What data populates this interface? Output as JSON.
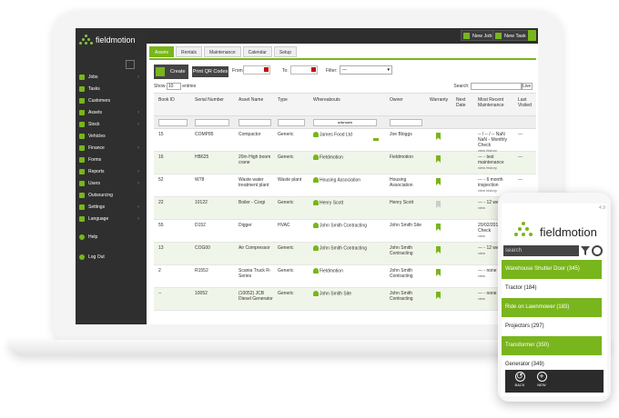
{
  "brand": {
    "name": "fieldmotion"
  },
  "topbar": {
    "new_job": "New Job",
    "new_task": "New Task"
  },
  "sidebar": {
    "items": [
      {
        "label": "Jobs",
        "icon": "jobs-icon",
        "chevron": "›"
      },
      {
        "label": "Tasks",
        "icon": "tasks-icon",
        "chevron": ""
      },
      {
        "label": "Customers",
        "icon": "customers-icon",
        "chevron": ""
      },
      {
        "label": "Assets",
        "icon": "assets-icon",
        "chevron": "›"
      },
      {
        "label": "Stock",
        "icon": "stock-icon",
        "chevron": "›"
      },
      {
        "label": "Vehicles",
        "icon": "vehicles-icon",
        "chevron": ""
      },
      {
        "label": "Finance",
        "icon": "finance-icon",
        "chevron": "›"
      },
      {
        "label": "Forms",
        "icon": "forms-icon",
        "chevron": ""
      },
      {
        "label": "Reports",
        "icon": "reports-icon",
        "chevron": "›"
      },
      {
        "label": "Users",
        "icon": "users-icon",
        "chevron": "›"
      },
      {
        "label": "Outsourcing",
        "icon": "outsourcing-icon",
        "chevron": ""
      },
      {
        "label": "Settings",
        "icon": "settings-icon",
        "chevron": "›"
      },
      {
        "label": "Language",
        "icon": "language-icon",
        "chevron": "›"
      }
    ],
    "help": "Help",
    "logout": "Log Out"
  },
  "tabs": [
    "Assets",
    "Rentals",
    "Maintenance",
    "Calendar",
    "Setup"
  ],
  "toolbar": {
    "create": "Create",
    "print_qr": "Print QR Codes",
    "from_label": "From:",
    "to_label": "To:",
    "filter_label": "Filter:",
    "filter_value": "---"
  },
  "table_controls": {
    "show_label": "Show",
    "show_value": "10",
    "entries_label": "entries",
    "search_label": "Search:",
    "live_label": "Live"
  },
  "table": {
    "headers": [
      "Book ID",
      "Serial Number",
      "Asset Name",
      "Type",
      "Whereabouts",
      "Owner",
      "Warranty",
      "Next Date",
      "Most Recent Maintenance",
      "Last Visited"
    ],
    "whereabouts_filter": "unknown",
    "rows": [
      {
        "id": "15",
        "serial": "COMP85",
        "name": "Compactor",
        "type": "Generic",
        "where": "James Food Ltd",
        "owner": "Joe Bloggs",
        "next": "",
        "recent": "-- / -- / -- NaN NaN - Monthly Check",
        "recent_sub": "view  history",
        "last": "---",
        "warranty": "green",
        "key": true
      },
      {
        "id": "16",
        "serial": "HB625",
        "name": "20m High boom crane",
        "type": "Generic",
        "where": "Fieldmotion",
        "owner": "Fieldmotion",
        "next": "",
        "recent": "--- - test maintenance",
        "recent_sub": "view  history",
        "last": "---",
        "warranty": "green",
        "key": false
      },
      {
        "id": "52",
        "serial": "W78",
        "name": "Waste water treatment plant",
        "type": "Waste plant",
        "where": "Housing Association",
        "owner": "Housing Association",
        "next": "",
        "recent": "--- - 6 month inspection",
        "recent_sub": "view  history",
        "last": "---",
        "warranty": "green",
        "key": false
      },
      {
        "id": "22",
        "serial": "10122",
        "name": "Boiler - Corgi",
        "type": "Generic",
        "where": "Henry Scott",
        "owner": "Henry Scott",
        "next": "",
        "recent": "--- - 12 week",
        "recent_sub": "view",
        "last": "",
        "warranty": "grey",
        "key": false
      },
      {
        "id": "55",
        "serial": "D152",
        "name": "Digger",
        "type": "HVAC",
        "where": "John Smith Contracting",
        "owner": "John Smith Site",
        "next": "",
        "recent": "20/02/2016 Daily Check",
        "recent_sub": "view",
        "last": "",
        "warranty": "green",
        "key": false
      },
      {
        "id": "13",
        "serial": "COG00",
        "name": "Air Compressor",
        "type": "Generic",
        "where": "John Smith Contracting",
        "owner": "John Smith Contracting",
        "next": "",
        "recent": "--- - 12 week",
        "recent_sub": "view",
        "last": "",
        "warranty": "green",
        "key": false
      },
      {
        "id": "2",
        "serial": "R1552",
        "name": "Scania Truck R-Series",
        "type": "Generic",
        "where": "Fieldmotion",
        "owner": "John Smith Contracting",
        "next": "",
        "recent": "--- - none",
        "recent_sub": "view",
        "last": "",
        "warranty": "green",
        "key": false
      },
      {
        "id": "--",
        "serial": "10052",
        "name": "(10052) JCB Diesel Generator",
        "type": "Generic",
        "where": "John Smith Site",
        "owner": "John Smith Contracting",
        "next": "",
        "recent": "--- - none",
        "recent_sub": "view",
        "last": "",
        "warranty": "green",
        "key": false
      }
    ]
  },
  "phone": {
    "version": "4.9",
    "search_placeholder": "search",
    "items": [
      {
        "label": "Warehouse Shutter Door (345)",
        "highlight": true
      },
      {
        "label": "Tractor (184)",
        "highlight": false
      },
      {
        "label": "Ride on Lawnmower (183)",
        "highlight": true
      },
      {
        "label": "Projectors (297)",
        "highlight": false
      },
      {
        "label": "Transformer (350)",
        "highlight": true
      },
      {
        "label": "Generator (349)",
        "highlight": false
      }
    ],
    "back": "BACK",
    "new": "NEW"
  },
  "colors": {
    "accent": "#79b51c",
    "dark": "#2f2f2f"
  }
}
